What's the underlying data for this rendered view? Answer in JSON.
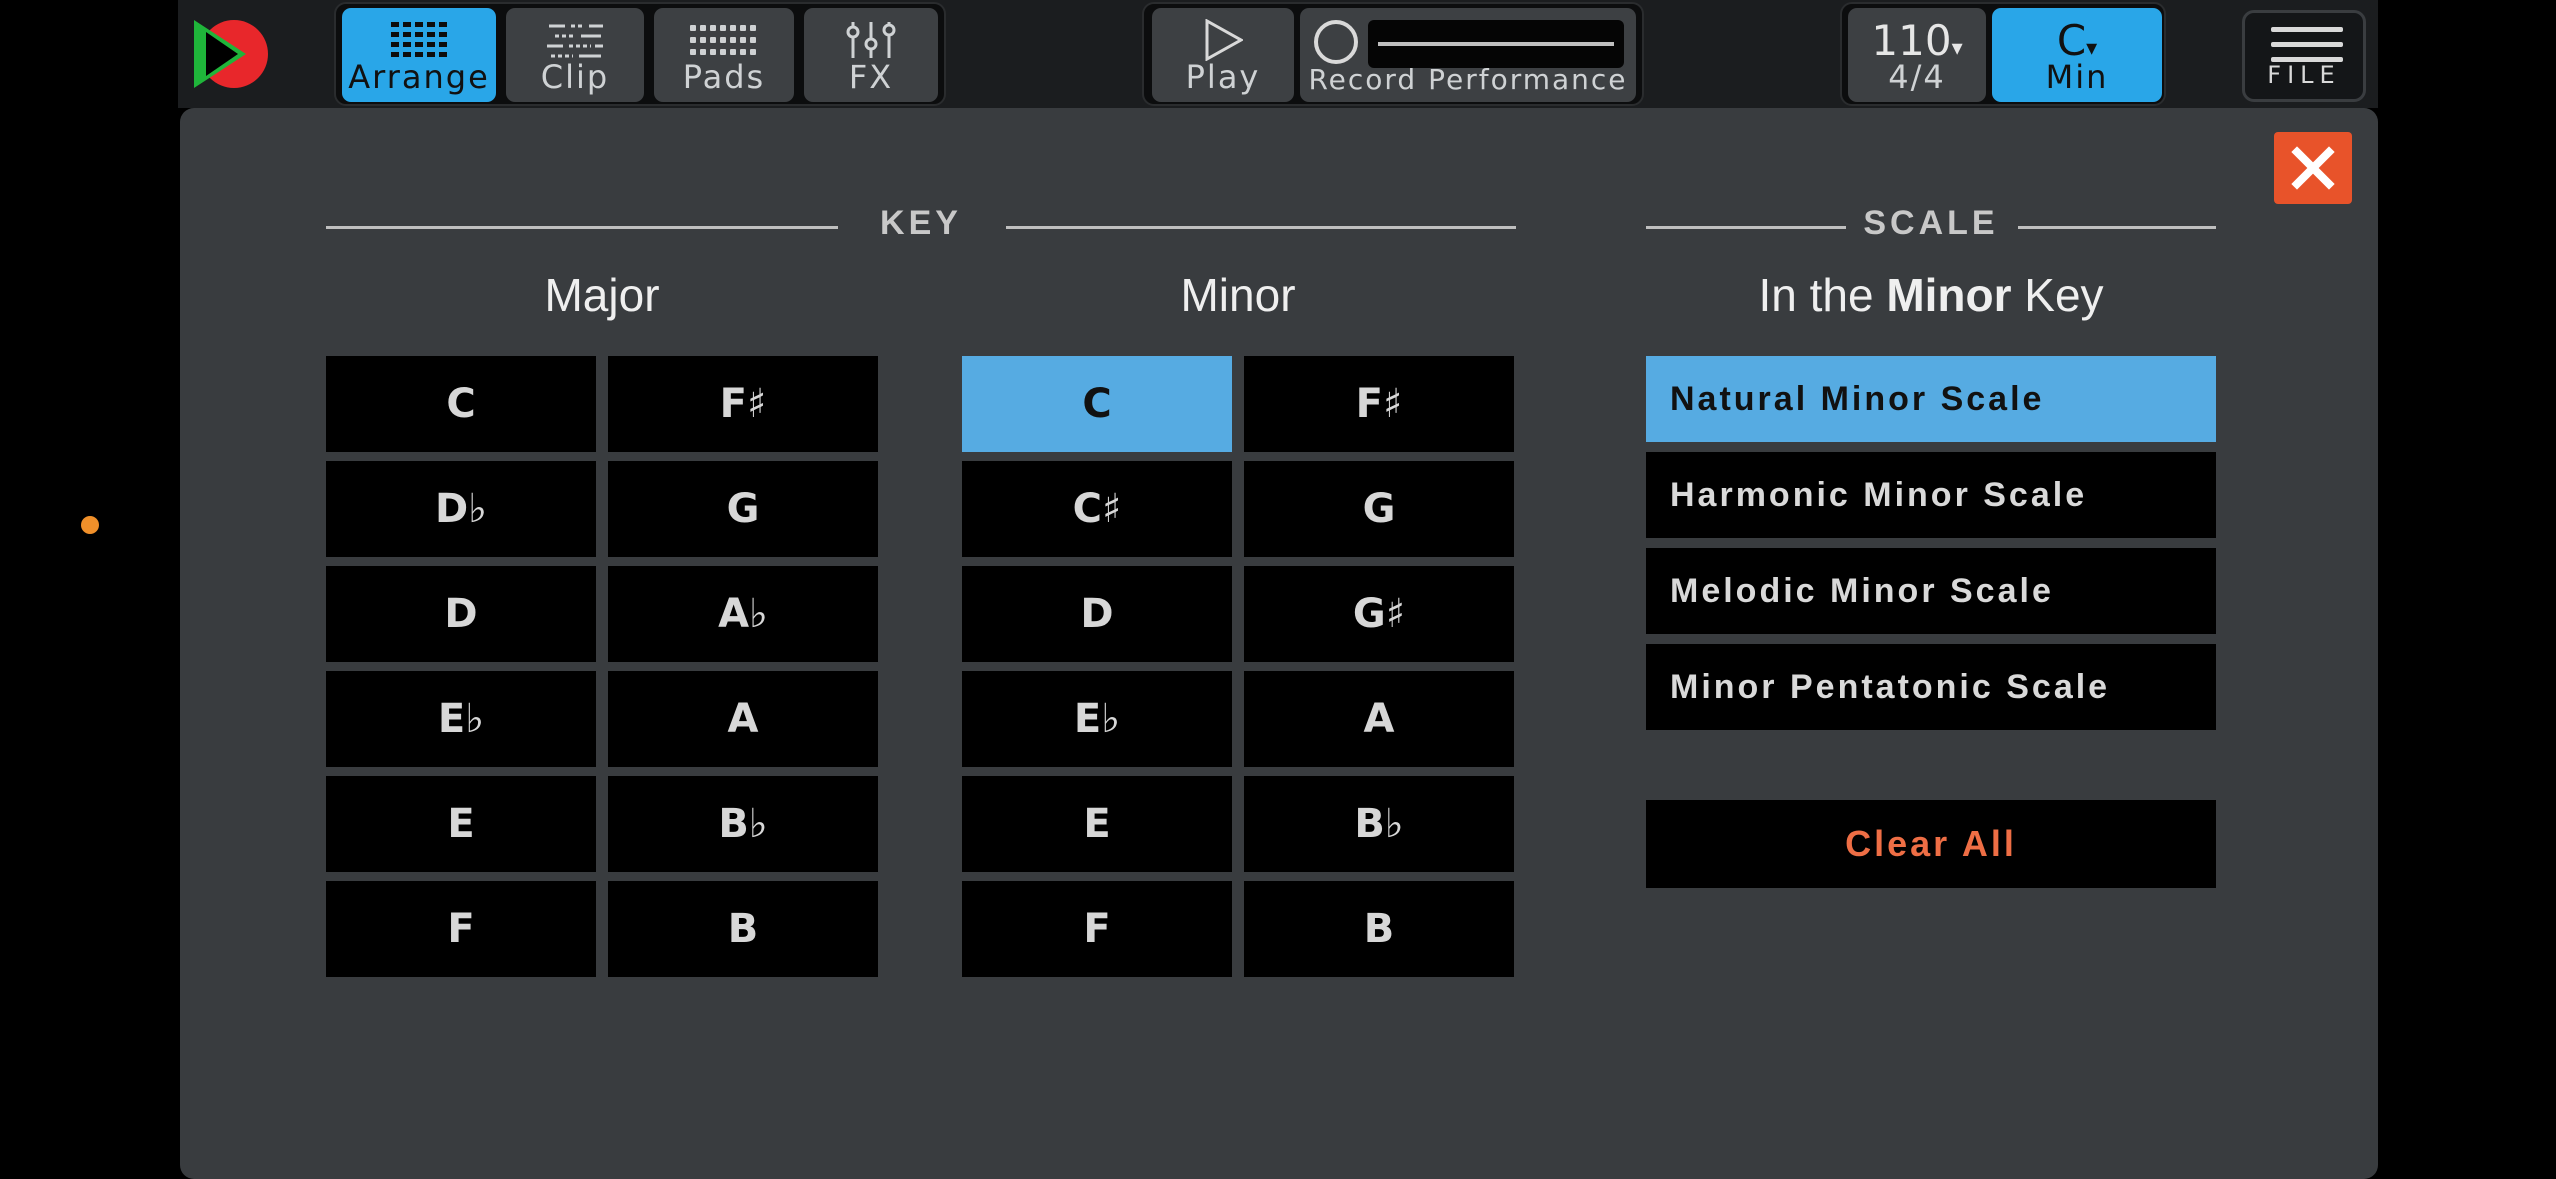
{
  "toolbar": {
    "tabs": [
      {
        "label": "Arrange",
        "icon": "grid-icon"
      },
      {
        "label": "Clip",
        "icon": "piano-roll-icon"
      },
      {
        "label": "Pads",
        "icon": "pads-icon"
      },
      {
        "label": "FX",
        "icon": "sliders-icon"
      }
    ],
    "play_label": "Play",
    "record_label": "Record Performance",
    "tempo": "110",
    "time_signature": "4/4",
    "key_root": "C",
    "key_mode": "Min",
    "file_label": "FILE"
  },
  "key_section": {
    "title": "KEY",
    "major_title": "Major",
    "minor_title": "Minor",
    "major_keys": [
      "C",
      "F♯",
      "D♭",
      "G",
      "D",
      "A♭",
      "E♭",
      "A",
      "E",
      "B♭",
      "F",
      "B"
    ],
    "minor_keys": [
      "C",
      "F♯",
      "C♯",
      "G",
      "D",
      "G♯",
      "E♭",
      "A",
      "E",
      "B♭",
      "F",
      "B"
    ],
    "selected_minor": "C"
  },
  "scale_section": {
    "title": "SCALE",
    "subtitle_prefix": "In the",
    "subtitle_bold": "Minor",
    "subtitle_suffix": "Key",
    "scales": [
      "Natural Minor Scale",
      "Harmonic Minor Scale",
      "Melodic Minor Scale",
      "Minor Pentatonic Scale"
    ],
    "selected_scale": "Natural Minor Scale",
    "clear_label": "Clear All"
  },
  "colors": {
    "accent": "#29a6e8",
    "selected": "#56abe2",
    "close": "#e8532a",
    "clear_text": "#ee6e45"
  }
}
